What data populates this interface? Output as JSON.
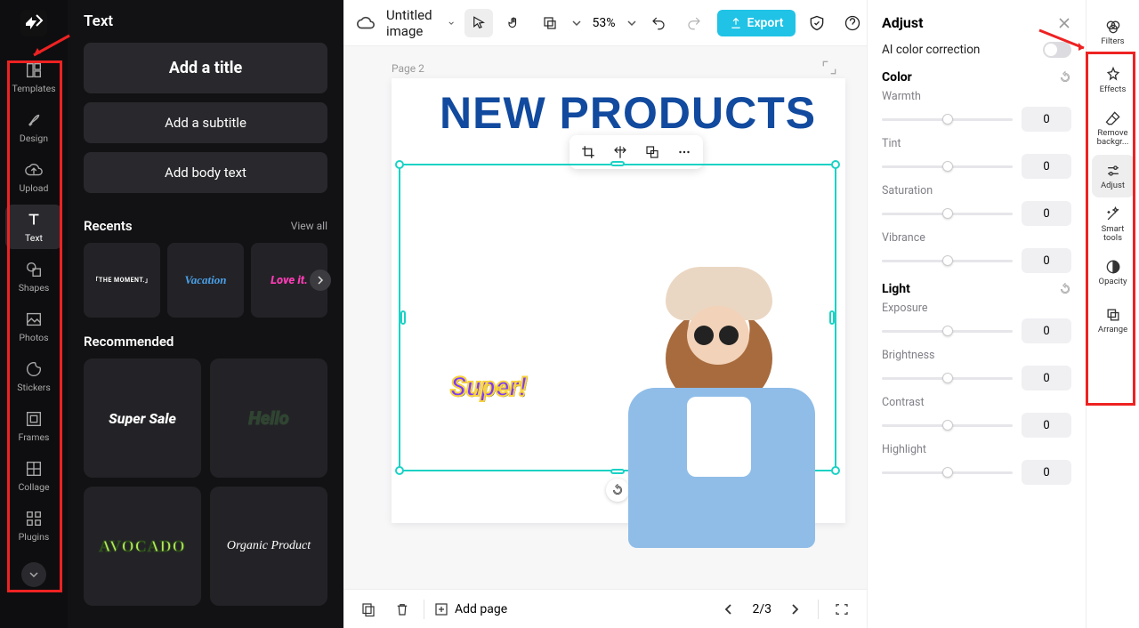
{
  "project": {
    "name": "Untitled image"
  },
  "zoom": "53%",
  "export_label": "Export",
  "left_rail": {
    "items": [
      {
        "label": "Templates",
        "icon": "templates-icon"
      },
      {
        "label": "Design",
        "icon": "design-icon"
      },
      {
        "label": "Upload",
        "icon": "upload-icon"
      },
      {
        "label": "Text",
        "icon": "text-icon"
      },
      {
        "label": "Shapes",
        "icon": "shapes-icon"
      },
      {
        "label": "Photos",
        "icon": "photos-icon"
      },
      {
        "label": "Stickers",
        "icon": "stickers-icon"
      },
      {
        "label": "Frames",
        "icon": "frames-icon"
      },
      {
        "label": "Collage",
        "icon": "collage-icon"
      },
      {
        "label": "Plugins",
        "icon": "plugins-icon"
      }
    ]
  },
  "text_panel": {
    "title": "Text",
    "add_title": "Add a title",
    "add_subtitle": "Add a subtitle",
    "add_body": "Add body text",
    "recents_label": "Recents",
    "view_all": "View all",
    "recents": [
      "「THE MOMENT.」",
      "Vacation",
      "Love it."
    ],
    "recommended_label": "Recommended",
    "recommended": [
      "Super Sale",
      "Hello",
      "AVOCADO",
      "Organic Product"
    ]
  },
  "canvas": {
    "page_label": "Page 2",
    "headline": "NEW PRODUCTS",
    "overlay_text": "Super!"
  },
  "adjust_panel": {
    "title": "Adjust",
    "ai_label": "AI color correction",
    "ai_on": false,
    "groups": [
      {
        "name": "Color",
        "sliders": [
          {
            "label": "Warmth",
            "value": 0
          },
          {
            "label": "Tint",
            "value": 0
          },
          {
            "label": "Saturation",
            "value": 0
          },
          {
            "label": "Vibrance",
            "value": 0
          }
        ]
      },
      {
        "name": "Light",
        "sliders": [
          {
            "label": "Exposure",
            "value": 0
          },
          {
            "label": "Brightness",
            "value": 0
          },
          {
            "label": "Contrast",
            "value": 0
          },
          {
            "label": "Highlight",
            "value": 0
          }
        ]
      }
    ]
  },
  "right_rail": {
    "items": [
      {
        "label": "Filters",
        "icon": "filters-icon"
      },
      {
        "label": "Effects",
        "icon": "effects-icon"
      },
      {
        "label": "Remove backgr...",
        "icon": "erase-icon"
      },
      {
        "label": "Adjust",
        "icon": "adjust-icon"
      },
      {
        "label": "Smart tools",
        "icon": "wand-icon"
      },
      {
        "label": "Opacity",
        "icon": "opacity-icon"
      },
      {
        "label": "Arrange",
        "icon": "arrange-icon"
      }
    ]
  },
  "bottombar": {
    "add_page": "Add page",
    "page_indicator": "2/3"
  }
}
